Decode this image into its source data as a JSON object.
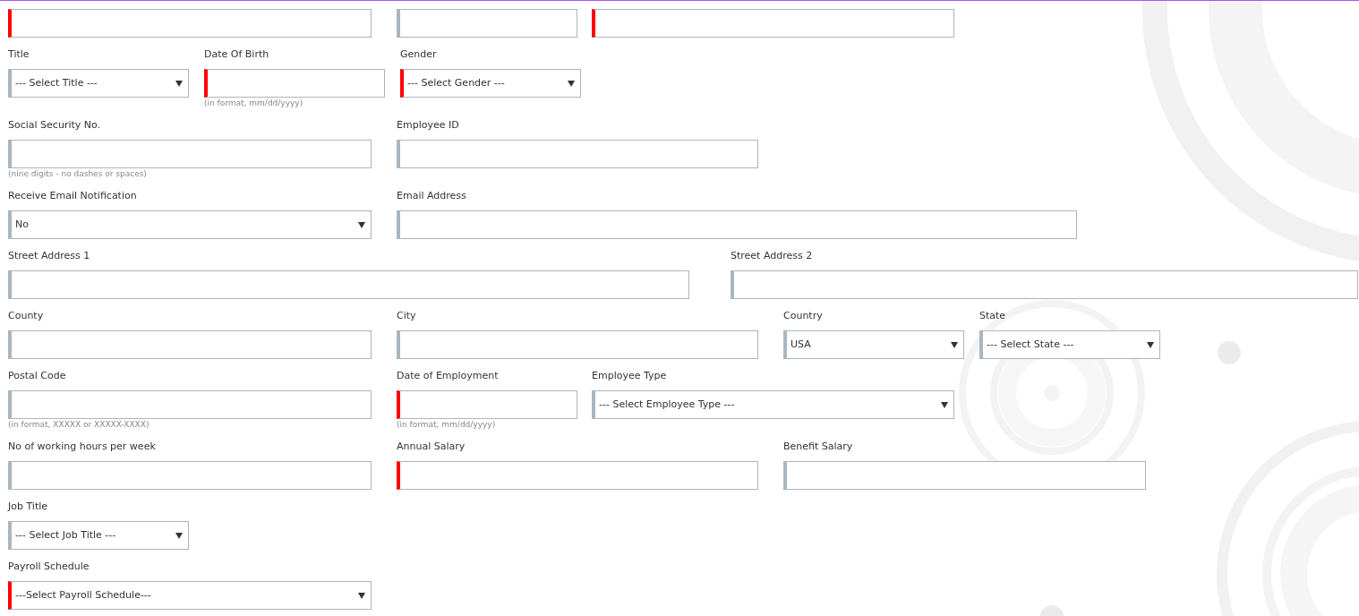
{
  "rows": [
    {
      "fields": [
        {
          "kind": "text",
          "required": true
        },
        {
          "kind": "text",
          "required": false
        },
        {
          "kind": "text",
          "required": true
        }
      ]
    },
    {
      "fields": [
        {
          "label": "Title",
          "kind": "select",
          "value": "--- Select Title ---",
          "required": false
        },
        {
          "label": "Date Of Birth",
          "kind": "text",
          "required": true,
          "hint": "(in format, mm/dd/yyyy)"
        },
        {
          "label": "Gender",
          "kind": "select",
          "value": "--- Select Gender ---",
          "required": true
        }
      ]
    },
    {
      "fields": [
        {
          "label": "Social Security No.",
          "kind": "text",
          "required": false,
          "hint": "(nine digits - no dashes or spaces)"
        },
        {
          "label": "Employee ID",
          "kind": "text",
          "required": false
        }
      ]
    },
    {
      "fields": [
        {
          "label": "Receive Email Notification",
          "kind": "select",
          "value": "No",
          "required": false
        },
        {
          "label": "Email Address",
          "kind": "text",
          "required": false
        }
      ]
    },
    {
      "fields": [
        {
          "label": "Street Address 1",
          "kind": "text",
          "required": false
        },
        {
          "label": "Street Address 2",
          "kind": "text",
          "required": false
        }
      ]
    },
    {
      "fields": [
        {
          "label": "County",
          "kind": "text",
          "required": false
        },
        {
          "label": "City",
          "kind": "text",
          "required": false
        },
        {
          "label": "Country",
          "kind": "select",
          "value": "USA",
          "required": false
        },
        {
          "label": "State",
          "kind": "select",
          "value": "--- Select State ---",
          "required": false
        }
      ]
    },
    {
      "fields": [
        {
          "label": "Postal Code",
          "kind": "text",
          "required": false,
          "hint": "(in format, XXXXX or XXXXX-XXXX)"
        },
        {
          "label": "Date of Employment",
          "kind": "text",
          "required": true,
          "hint": "(in format, mm/dd/yyyy)"
        },
        {
          "label": "Employee Type",
          "kind": "select",
          "value": "--- Select Employee Type ---",
          "required": false
        }
      ]
    },
    {
      "fields": [
        {
          "label": "No of working hours per week",
          "kind": "text",
          "required": false
        },
        {
          "label": "Annual Salary",
          "kind": "text",
          "required": true
        },
        {
          "label": "Benefit Salary",
          "kind": "text",
          "required": false
        }
      ]
    },
    {
      "fields": [
        {
          "label": "Job Title",
          "kind": "select",
          "value": "--- Select Job Title ---",
          "required": false
        }
      ]
    },
    {
      "fields": [
        {
          "label": "Payroll Schedule",
          "kind": "select",
          "value": "---Select Payroll Schedule---",
          "required": true
        }
      ]
    }
  ]
}
